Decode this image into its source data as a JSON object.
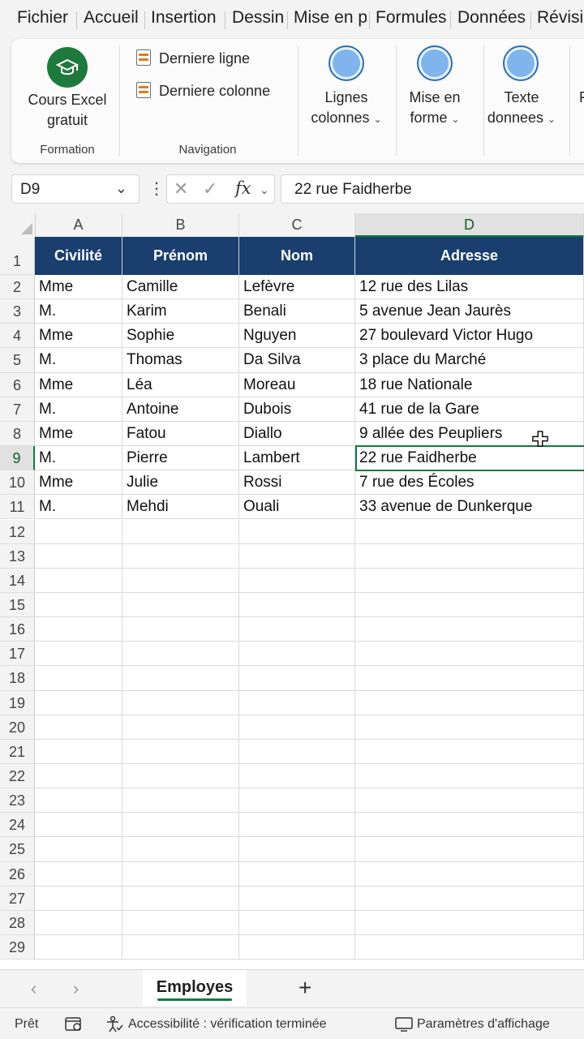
{
  "menu": {
    "tabs": [
      "Fichier",
      "Accueil",
      "Insertion",
      "Dessin",
      "Mise en p",
      "Formules",
      "Données",
      "Révisio"
    ]
  },
  "ribbon": {
    "formation": {
      "button_label_1": "Cours Excel",
      "button_label_2": "gratuit",
      "group_label": "Formation"
    },
    "navigation": {
      "item_1": "Derniere ligne",
      "item_2": "Derniere colonne",
      "group_label": "Navigation"
    },
    "macros": [
      {
        "line1": "Lignes",
        "line2": "colonnes"
      },
      {
        "line1": "Mise en",
        "line2": "forme"
      },
      {
        "line1": "Texte",
        "line2": "donnees"
      }
    ],
    "cut_label": "F"
  },
  "formula_bar": {
    "name_box": "D9",
    "fx": "fx",
    "value": "22 rue Faidherbe"
  },
  "sheet": {
    "column_letters": [
      "A",
      "B",
      "C",
      "D"
    ],
    "active_column": "D",
    "headers": [
      "Civilité",
      "Prénom",
      "Nom",
      "Adresse"
    ],
    "rows": [
      [
        "Mme",
        "Camille",
        "Lefèvre",
        "12 rue des Lilas"
      ],
      [
        "M.",
        "Karim",
        "Benali",
        "5 avenue Jean Jaurès"
      ],
      [
        "Mme",
        "Sophie",
        "Nguyen",
        "27 boulevard Victor Hugo"
      ],
      [
        "M.",
        "Thomas",
        "Da Silva",
        "3 place du Marché"
      ],
      [
        "Mme",
        "Léa",
        "Moreau",
        "18 rue Nationale"
      ],
      [
        "M.",
        "Antoine",
        "Dubois",
        "41 rue de la Gare"
      ],
      [
        "Mme",
        "Fatou",
        "Diallo",
        "9 allée des Peupliers"
      ],
      [
        "M.",
        "Pierre",
        "Lambert",
        "22 rue Faidherbe"
      ],
      [
        "Mme",
        "Julie",
        "Rossi",
        "7 rue des Écoles"
      ],
      [
        "M.",
        "Mehdi",
        "Ouali",
        "33 avenue de Dunkerque"
      ]
    ],
    "row_numbers": [
      "1",
      "2",
      "3",
      "4",
      "5",
      "6",
      "7",
      "8",
      "9",
      "10",
      "11",
      "12",
      "13",
      "14",
      "15",
      "16",
      "17",
      "18",
      "19",
      "20",
      "21",
      "22",
      "23",
      "24",
      "25",
      "26",
      "27",
      "28",
      "29"
    ],
    "selected_cell": "D9"
  },
  "sheet_tabs": {
    "active": "Employes",
    "add": "+",
    "prev": "‹",
    "next": "›"
  },
  "status": {
    "ready": "Prêt",
    "accessibility": "Accessibilité : vérification terminée",
    "display": "Paramètres d'affichage"
  },
  "colors": {
    "header_fill": "#1a3e6e",
    "selection": "#107c41",
    "excel_green": "#1e7a3c"
  }
}
